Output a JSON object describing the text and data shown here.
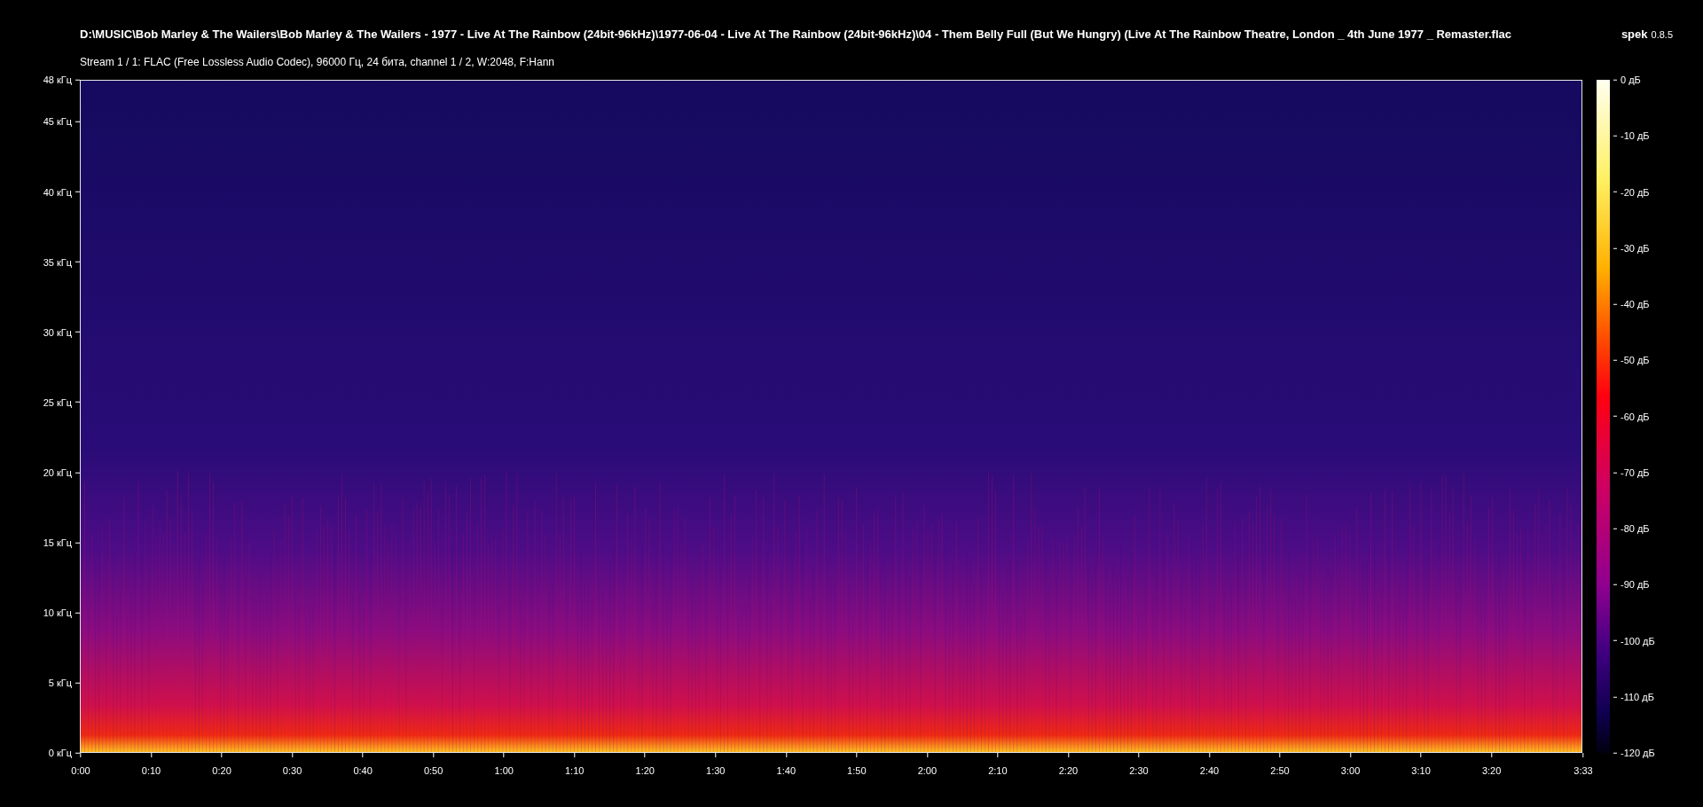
{
  "header": {
    "file_path": "D:\\MUSIC\\Bob Marley & The Wailers\\Bob Marley & The Wailers - 1977 - Live At The Rainbow  (24bit-96kHz)\\1977-06-04 - Live At The Rainbow (24bit-96kHz)\\04 - Them Belly Full (But We Hungry) (Live At The Rainbow Theatre, London _ 4th June 1977 _ Remaster.flac",
    "app_name": "spek",
    "app_version": "0.8.5",
    "stream_info": "Stream 1 / 1: FLAC (Free Lossless Audio Codec), 96000 Гц, 24 бита, channel 1 / 2, W:2048, F:Hann"
  },
  "frequency_axis": [
    "48 кГц",
    "45 кГц",
    "40 кГц",
    "35 кГц",
    "30 кГц",
    "25 кГц",
    "20 кГц",
    "15 кГц",
    "10 кГц",
    "5 кГц",
    "0 кГц"
  ],
  "time_axis": [
    "0:00",
    "0:10",
    "0:20",
    "0:30",
    "0:40",
    "0:50",
    "1:00",
    "1:10",
    "1:20",
    "1:30",
    "1:40",
    "1:50",
    "2:00",
    "2:10",
    "2:20",
    "2:30",
    "2:40",
    "2:50",
    "3:00",
    "3:10",
    "3:20",
    "3:33"
  ],
  "level_scale": [
    "0 дБ",
    "-10 дБ",
    "-20 дБ",
    "-30 дБ",
    "-40 дБ",
    "-50 дБ",
    "-60 дБ",
    "-70 дБ",
    "-80 дБ",
    "-90 дБ",
    "-100 дБ",
    "-110 дБ",
    "-120 дБ"
  ]
}
